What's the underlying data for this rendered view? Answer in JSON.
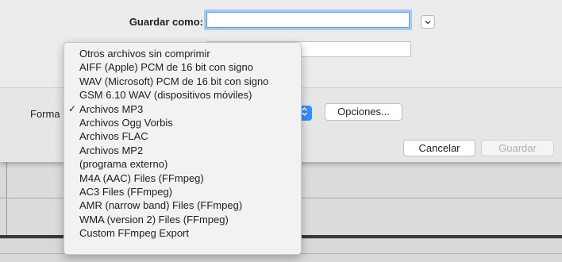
{
  "dialog": {
    "save_as_label": "Guardar como:",
    "save_as_value": "",
    "format_label": "Forma",
    "options_button": "Opciones...",
    "cancel_button": "Cancelar",
    "save_button": "Guardar"
  },
  "format_menu": {
    "selected": "Archivos MP3",
    "check_glyph": "✓",
    "items": [
      "Otros archivos sin comprimir",
      "AIFF (Apple) PCM de 16 bit con signo",
      "WAV (Microsoft) PCM de 16 bit con signo",
      "GSM 6.10 WAV (dispositivos móviles)",
      "Archivos MP3",
      "Archivos Ogg Vorbis",
      "Archivos FLAC",
      "Archivos MP2",
      "(programa externo)",
      "M4A (AAC) Files (FFmpeg)",
      "AC3 Files (FFmpeg)",
      "AMR (narrow band) Files (FFmpeg)",
      "WMA (version 2) Files (FFmpeg)",
      "Custom FFmpeg Export"
    ]
  },
  "colors": {
    "accent": "#3c8cf5",
    "focus_ring": "#5a9ef2",
    "sheet_bg": "#ececec",
    "menu_bg": "#f2f2f2"
  },
  "icons": {
    "expand": "chevron-down-icon",
    "popup": "popup-arrows-icon",
    "check": "checkmark-icon"
  }
}
